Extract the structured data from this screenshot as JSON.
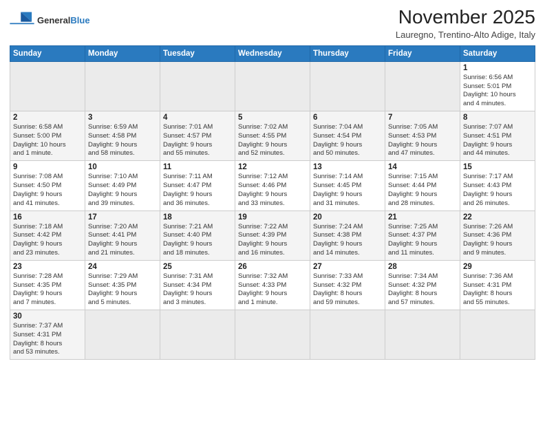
{
  "header": {
    "logo_line1": "General",
    "logo_line2": "Blue",
    "month_title": "November 2025",
    "location": "Lauregno, Trentino-Alto Adige, Italy"
  },
  "weekdays": [
    "Sunday",
    "Monday",
    "Tuesday",
    "Wednesday",
    "Thursday",
    "Friday",
    "Saturday"
  ],
  "weeks": [
    [
      {
        "day": "",
        "info": ""
      },
      {
        "day": "",
        "info": ""
      },
      {
        "day": "",
        "info": ""
      },
      {
        "day": "",
        "info": ""
      },
      {
        "day": "",
        "info": ""
      },
      {
        "day": "",
        "info": ""
      },
      {
        "day": "1",
        "info": "Sunrise: 6:56 AM\nSunset: 5:01 PM\nDaylight: 10 hours\nand 4 minutes."
      }
    ],
    [
      {
        "day": "2",
        "info": "Sunrise: 6:58 AM\nSunset: 5:00 PM\nDaylight: 10 hours\nand 1 minute."
      },
      {
        "day": "3",
        "info": "Sunrise: 6:59 AM\nSunset: 4:58 PM\nDaylight: 9 hours\nand 58 minutes."
      },
      {
        "day": "4",
        "info": "Sunrise: 7:01 AM\nSunset: 4:57 PM\nDaylight: 9 hours\nand 55 minutes."
      },
      {
        "day": "5",
        "info": "Sunrise: 7:02 AM\nSunset: 4:55 PM\nDaylight: 9 hours\nand 52 minutes."
      },
      {
        "day": "6",
        "info": "Sunrise: 7:04 AM\nSunset: 4:54 PM\nDaylight: 9 hours\nand 50 minutes."
      },
      {
        "day": "7",
        "info": "Sunrise: 7:05 AM\nSunset: 4:53 PM\nDaylight: 9 hours\nand 47 minutes."
      },
      {
        "day": "8",
        "info": "Sunrise: 7:07 AM\nSunset: 4:51 PM\nDaylight: 9 hours\nand 44 minutes."
      }
    ],
    [
      {
        "day": "9",
        "info": "Sunrise: 7:08 AM\nSunset: 4:50 PM\nDaylight: 9 hours\nand 41 minutes."
      },
      {
        "day": "10",
        "info": "Sunrise: 7:10 AM\nSunset: 4:49 PM\nDaylight: 9 hours\nand 39 minutes."
      },
      {
        "day": "11",
        "info": "Sunrise: 7:11 AM\nSunset: 4:47 PM\nDaylight: 9 hours\nand 36 minutes."
      },
      {
        "day": "12",
        "info": "Sunrise: 7:12 AM\nSunset: 4:46 PM\nDaylight: 9 hours\nand 33 minutes."
      },
      {
        "day": "13",
        "info": "Sunrise: 7:14 AM\nSunset: 4:45 PM\nDaylight: 9 hours\nand 31 minutes."
      },
      {
        "day": "14",
        "info": "Sunrise: 7:15 AM\nSunset: 4:44 PM\nDaylight: 9 hours\nand 28 minutes."
      },
      {
        "day": "15",
        "info": "Sunrise: 7:17 AM\nSunset: 4:43 PM\nDaylight: 9 hours\nand 26 minutes."
      }
    ],
    [
      {
        "day": "16",
        "info": "Sunrise: 7:18 AM\nSunset: 4:42 PM\nDaylight: 9 hours\nand 23 minutes."
      },
      {
        "day": "17",
        "info": "Sunrise: 7:20 AM\nSunset: 4:41 PM\nDaylight: 9 hours\nand 21 minutes."
      },
      {
        "day": "18",
        "info": "Sunrise: 7:21 AM\nSunset: 4:40 PM\nDaylight: 9 hours\nand 18 minutes."
      },
      {
        "day": "19",
        "info": "Sunrise: 7:22 AM\nSunset: 4:39 PM\nDaylight: 9 hours\nand 16 minutes."
      },
      {
        "day": "20",
        "info": "Sunrise: 7:24 AM\nSunset: 4:38 PM\nDaylight: 9 hours\nand 14 minutes."
      },
      {
        "day": "21",
        "info": "Sunrise: 7:25 AM\nSunset: 4:37 PM\nDaylight: 9 hours\nand 11 minutes."
      },
      {
        "day": "22",
        "info": "Sunrise: 7:26 AM\nSunset: 4:36 PM\nDaylight: 9 hours\nand 9 minutes."
      }
    ],
    [
      {
        "day": "23",
        "info": "Sunrise: 7:28 AM\nSunset: 4:35 PM\nDaylight: 9 hours\nand 7 minutes."
      },
      {
        "day": "24",
        "info": "Sunrise: 7:29 AM\nSunset: 4:35 PM\nDaylight: 9 hours\nand 5 minutes."
      },
      {
        "day": "25",
        "info": "Sunrise: 7:31 AM\nSunset: 4:34 PM\nDaylight: 9 hours\nand 3 minutes."
      },
      {
        "day": "26",
        "info": "Sunrise: 7:32 AM\nSunset: 4:33 PM\nDaylight: 9 hours\nand 1 minute."
      },
      {
        "day": "27",
        "info": "Sunrise: 7:33 AM\nSunset: 4:32 PM\nDaylight: 8 hours\nand 59 minutes."
      },
      {
        "day": "28",
        "info": "Sunrise: 7:34 AM\nSunset: 4:32 PM\nDaylight: 8 hours\nand 57 minutes."
      },
      {
        "day": "29",
        "info": "Sunrise: 7:36 AM\nSunset: 4:31 PM\nDaylight: 8 hours\nand 55 minutes."
      }
    ],
    [
      {
        "day": "30",
        "info": "Sunrise: 7:37 AM\nSunset: 4:31 PM\nDaylight: 8 hours\nand 53 minutes."
      },
      {
        "day": "",
        "info": ""
      },
      {
        "day": "",
        "info": ""
      },
      {
        "day": "",
        "info": ""
      },
      {
        "day": "",
        "info": ""
      },
      {
        "day": "",
        "info": ""
      },
      {
        "day": "",
        "info": ""
      }
    ]
  ]
}
